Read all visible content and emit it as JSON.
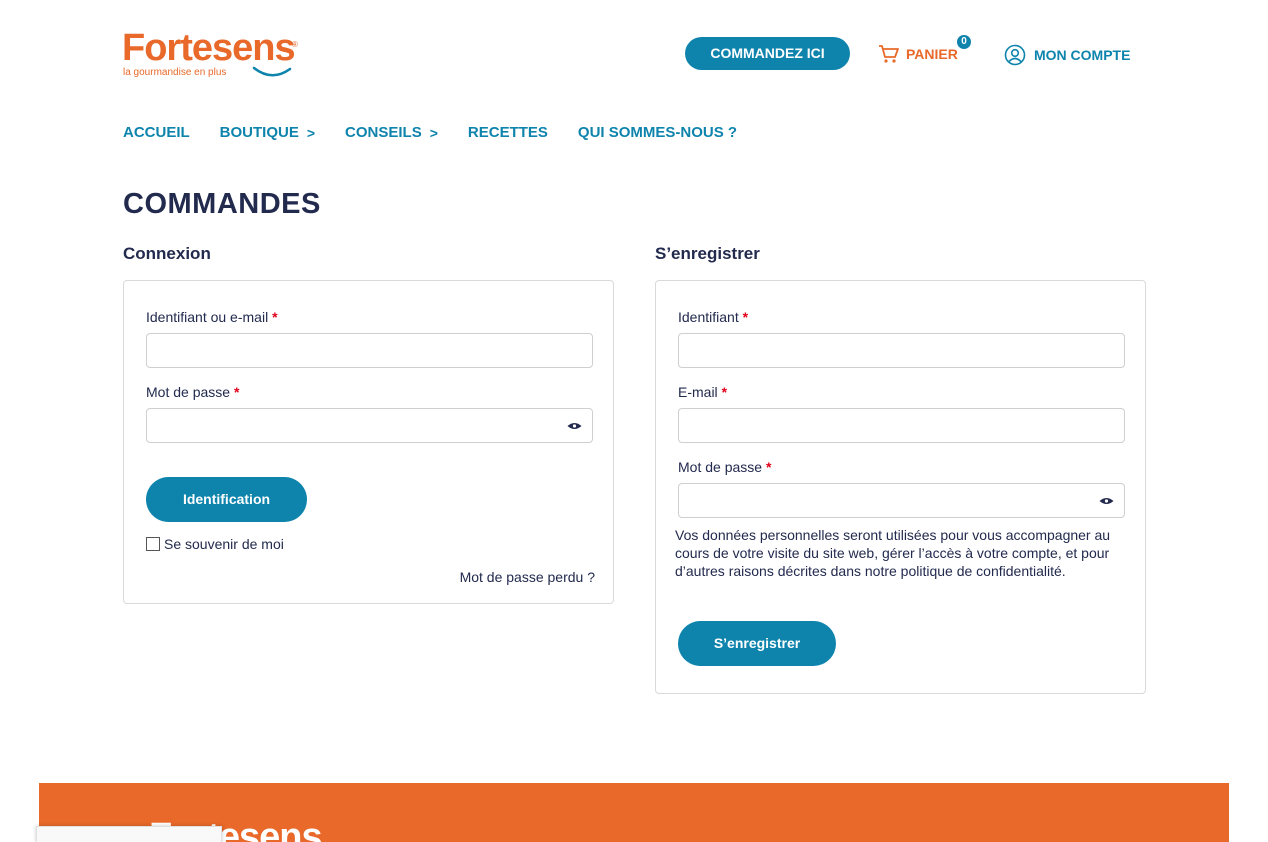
{
  "header": {
    "logo_text": "Fortesens",
    "logo_registered": "®",
    "logo_tagline": "la gourmandise en plus",
    "order_button": "COMMANDEZ ICI",
    "cart_label": "PANIER",
    "cart_count": "0",
    "cart_icon": "shopping-cart-icon",
    "account_label": "MON COMPTE",
    "account_icon": "user-circle-icon"
  },
  "nav": {
    "items": [
      {
        "label": "ACCUEIL",
        "chevron": ""
      },
      {
        "label": "BOUTIQUE",
        "chevron": ">"
      },
      {
        "label": "CONSEILS",
        "chevron": ">"
      },
      {
        "label": "RECETTES",
        "chevron": ""
      },
      {
        "label": "QUI SOMMES-NOUS ?",
        "chevron": ""
      }
    ]
  },
  "page": {
    "title": "COMMANDES"
  },
  "login": {
    "heading": "Connexion",
    "username_label": "Identifiant ou e-mail",
    "username_value": "",
    "password_label": "Mot de passe",
    "password_value": "",
    "required_mark": "*",
    "submit_label": "Identification",
    "remember_label": "Se souvenir de moi",
    "remember_checked": false,
    "lost_password": "Mot de passe perdu ?"
  },
  "register": {
    "heading": "S’enregistrer",
    "username_label": "Identifiant",
    "username_value": "",
    "email_label": "E-mail",
    "email_value": "",
    "password_label": "Mot de passe",
    "password_value": "",
    "required_mark": "*",
    "privacy_text": "Vos données personnelles seront utilisées pour vous accompagner au cours de votre visite du site web, gérer l’accès à votre compte, et pour d’autres raisons décrites dans notre politique de confidentialité.",
    "submit_label": "S’enregistrer"
  },
  "footer": {
    "logo_text": "Fortesens"
  },
  "colors": {
    "brand_orange": "#e8692a",
    "brand_blue": "#0e84ad",
    "heading_navy": "#222a4e",
    "required_red": "#e3001b"
  }
}
